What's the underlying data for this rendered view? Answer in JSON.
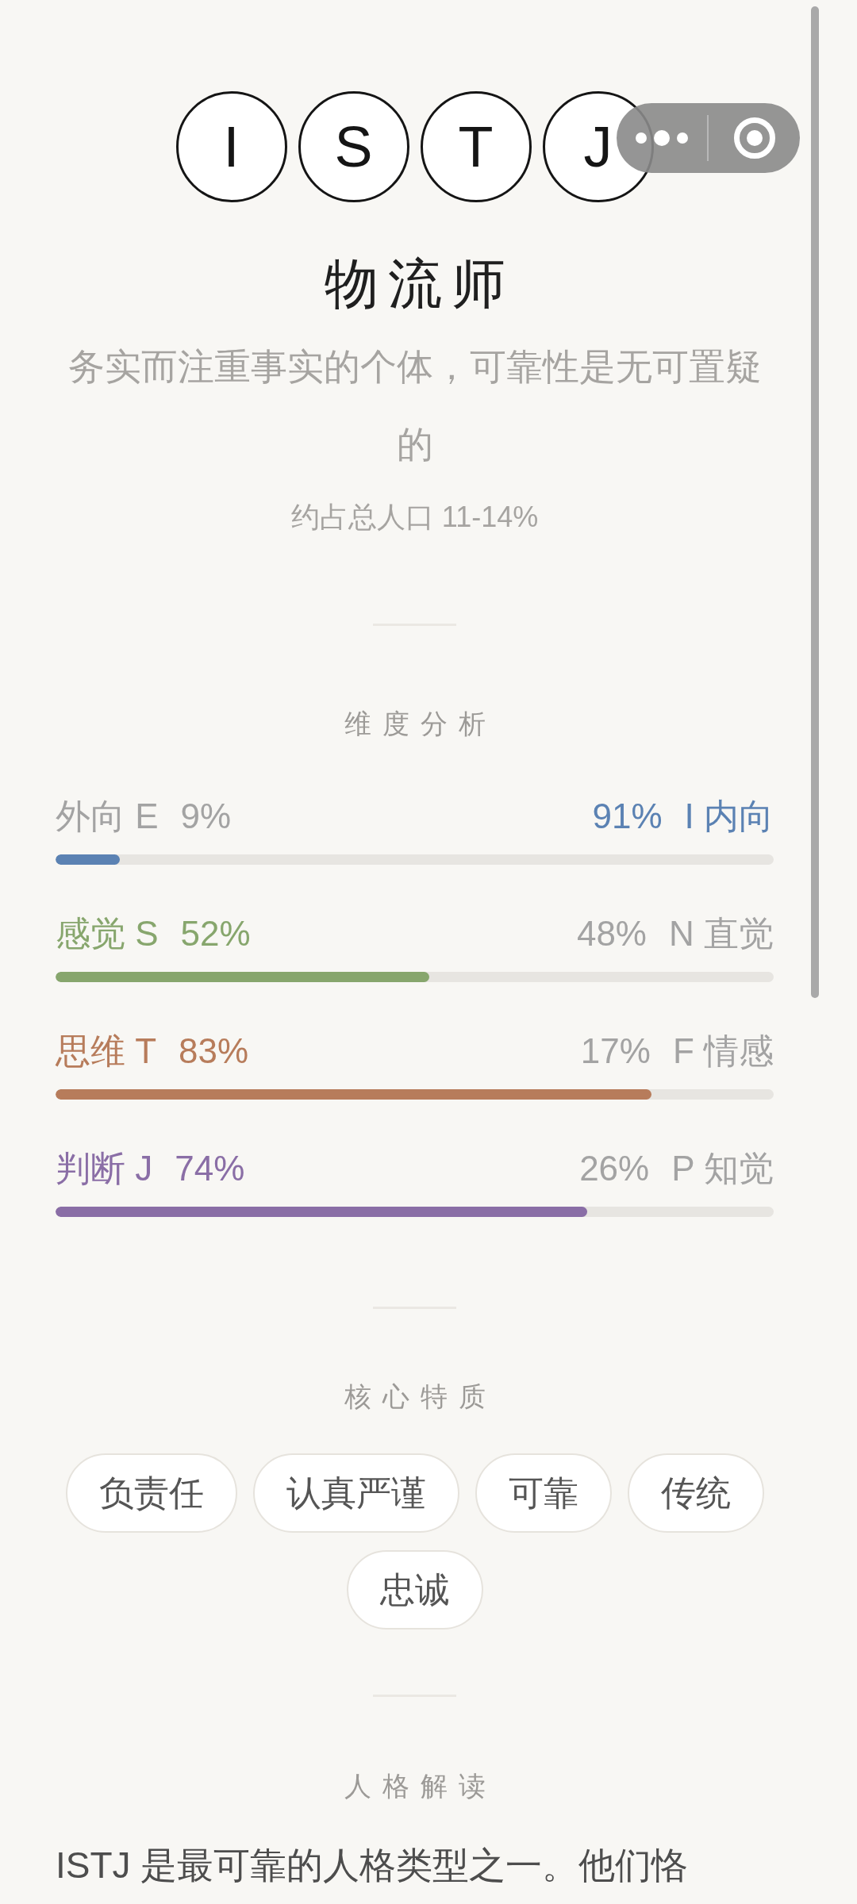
{
  "header": {
    "letters": [
      "I",
      "S",
      "T",
      "J"
    ],
    "title": "物流师",
    "subtitle": "务实而注重事实的个体，可靠性是无可置疑的",
    "population": "约占总人口 11-14%"
  },
  "dimensions": {
    "heading": "维度分析",
    "items": [
      {
        "left": {
          "label": "外向 E",
          "percent": "9%",
          "highlighted": false
        },
        "right": {
          "percent": "91%",
          "label": "I 内向",
          "highlighted": true
        },
        "color": "#5b82b3",
        "level": 0.09
      },
      {
        "left": {
          "label": "感觉 S",
          "percent": "52%",
          "highlighted": true
        },
        "right": {
          "percent": "48%",
          "label": "N 直觉",
          "highlighted": false
        },
        "color": "#87a66d",
        "level": 0.52
      },
      {
        "left": {
          "label": "思维 T",
          "percent": "83%",
          "highlighted": true
        },
        "right": {
          "percent": "17%",
          "label": "F 情感",
          "highlighted": false
        },
        "color": "#b77c5b",
        "level": 0.83
      },
      {
        "left": {
          "label": "判断 J",
          "percent": "74%",
          "highlighted": true
        },
        "right": {
          "percent": "26%",
          "label": "P 知觉",
          "highlighted": false
        },
        "color": "#8a6ea6",
        "level": 0.74
      }
    ]
  },
  "traits": {
    "heading": "核心特质",
    "tags": [
      "负责任",
      "认真严谨",
      "可靠",
      "传统",
      "忠诚"
    ]
  },
  "interpretation": {
    "heading": "人格解读",
    "text": "ISTJ 是最可靠的人格类型之一。他们恪"
  }
}
